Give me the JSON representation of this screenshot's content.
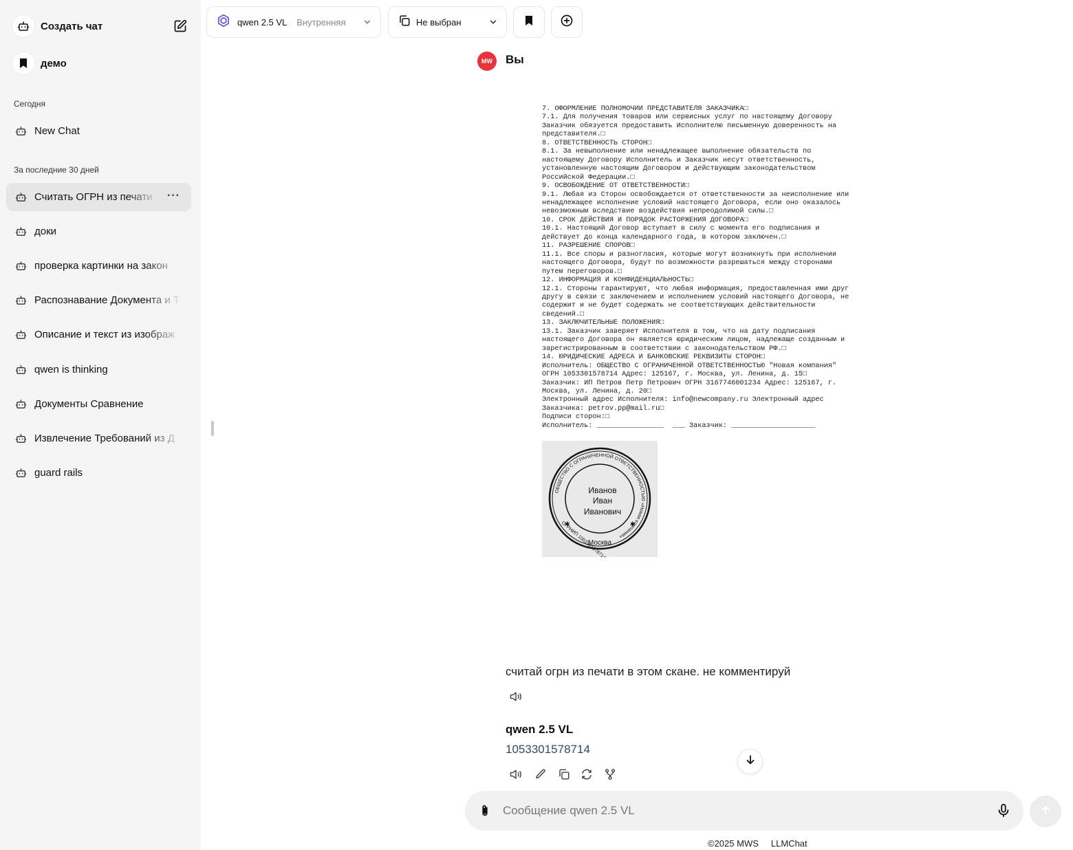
{
  "sidebar": {
    "new_chat_label": "Создать чат",
    "pinned_label": "демо",
    "section_today": "Сегодня",
    "section_30days": "За последние 30 дней",
    "today_items": [
      {
        "label": "New Chat"
      }
    ],
    "month_items": [
      {
        "label": "Считать ОГРН из печати"
      },
      {
        "label": "доки"
      },
      {
        "label": "проверка картинки на закон"
      },
      {
        "label": "Распознавание Документа и Т"
      },
      {
        "label": "Описание и текст из изображ"
      },
      {
        "label": "qwen is thinking"
      },
      {
        "label": "Документы Сравнение"
      },
      {
        "label": "Извлечение Требований из Д"
      },
      {
        "label": "guard rails"
      }
    ],
    "more_label": "···"
  },
  "topbar": {
    "model_name": "qwen 2.5 VL",
    "model_scope": "Внутренняя",
    "selector_label": "Не выбран"
  },
  "conversation": {
    "user_avatar": "MW",
    "user_name": "Вы",
    "scan_lines": [
      "7. ОФОРМЛЕНИЕ ПОЛНОМОЧИЙ ПРЕДСТАВИТЕЛЯ ЗАКАЗЧИКА□",
      "7.1. Для получения товаров или сервисных услуг по настоящему Договору",
      "Заказчик обязуется предоставить Исполнителю письменную доверенность на",
      "представителя.□",
      "8. ОТВЕТСТВЕННОСТЬ СТОРОН□",
      "8.1. За невыполнение или ненадлежащее выполнение обязательств по",
      "настоящему Договору Исполнитель и Заказчик несут ответственность,",
      "установленную настоящим Договором и действующим законодательством",
      "Российской Федерации.□",
      "9. ОСВОБОЖДЕНИЕ ОТ ОТВЕТСТВЕННОСТИ□",
      "9.1. Любая из Сторон освобождается от ответственности за неисполнение или",
      "ненадлежащее исполнение условий настоящего Договора, если оно оказалось",
      "невозможным вследствие воздействия непреодолимой силы.□",
      "10. СРОК ДЕЙСТВИЯ И ПОРЯДОК РАСТОРЖЕНИЯ ДОГОВОРА□",
      "10.1. Настоящий Договор вступает в силу с момента его подписания и",
      "действует до конца календарного года, в котором заключен.□",
      "11. РАЗРЕШЕНИЕ СПОРОВ□",
      "11.1. Все споры и разногласия, которые могут возникнуть при исполнении",
      "настоящего Договора, будут по возможности разрешаться между сторонами",
      "путем переговоров.□",
      "12. ИНФОРМАЦИЯ И КОНФИДЕНЦИАЛЬНОСТЬ□",
      "12.1. Стороны гарантируют, что любая информация, предоставленная ими друг",
      "другу в связи с заключением и исполнением условий настоящего Договора, не",
      "содержит и не будет содержать не соответствующих действительности",
      "сведений.□",
      "13. ЗАКЛЮЧИТЕЛЬНЫЕ ПОЛОЖЕНИЯ□",
      "13.1. Заказчик заверяет Исполнителя в том, что на дату подписания",
      "настоящего Договора он является юридическим лицом, надлежаще созданным и",
      "зарегистрированным в соответствии с законодательством РФ.□",
      "14. ЮРИДИЧЕСКИЕ АДРЕСА И БАНКОВСКИЕ РЕКВИЗИТЫ СТОРОН□",
      "Исполнитель: ОБЩЕСТВО С ОГРАНИЧЕННОЙ ОТВЕТСТВЕННОСТЬЮ \"Новая компания\"",
      "ОГРН 1053301578714 Адрес: 125167, г. Москва, ул. Ленина, д. 15□",
      "Заказчик: ИП Петров Петр Петрович ОГРН 3167746001234 Адрес: 125167, г.",
      "Москва, ул. Ленина, д. 20□",
      "Электронный адрес Исполнителя: info@newcompany.ru Электронный адрес",
      "Заказчика: petrov.pp@mail.ru□",
      "Подписи сторон:□",
      "Исполнитель: ________________  ___ Заказчик: ____________________"
    ],
    "stamp": {
      "ring_text": "ОБЩЕСТВО С ОГРАНИЧЕННОЙ ОТВЕТСТВЕННОСТЬЮ «Новая компания»",
      "center_line1": "Иванов",
      "center_line2": "Иван",
      "center_line3": "Иванович",
      "ogrnip": "ОГРНИП 1053301578714",
      "city": "Москва"
    },
    "user_message": "считай огрн из печати в этом скане. не комментируй",
    "bot_name": "qwen 2.5 VL",
    "bot_answer": "1053301578714"
  },
  "composer": {
    "placeholder": "Сообщение qwen 2.5 VL"
  },
  "footer": {
    "copyright": "©2025 MWS",
    "product": "LLMChat"
  },
  "colors": {
    "accent": "#e8323c",
    "sidebar_bg": "#f5f5f5",
    "answer_text": "#2f4a6a"
  }
}
